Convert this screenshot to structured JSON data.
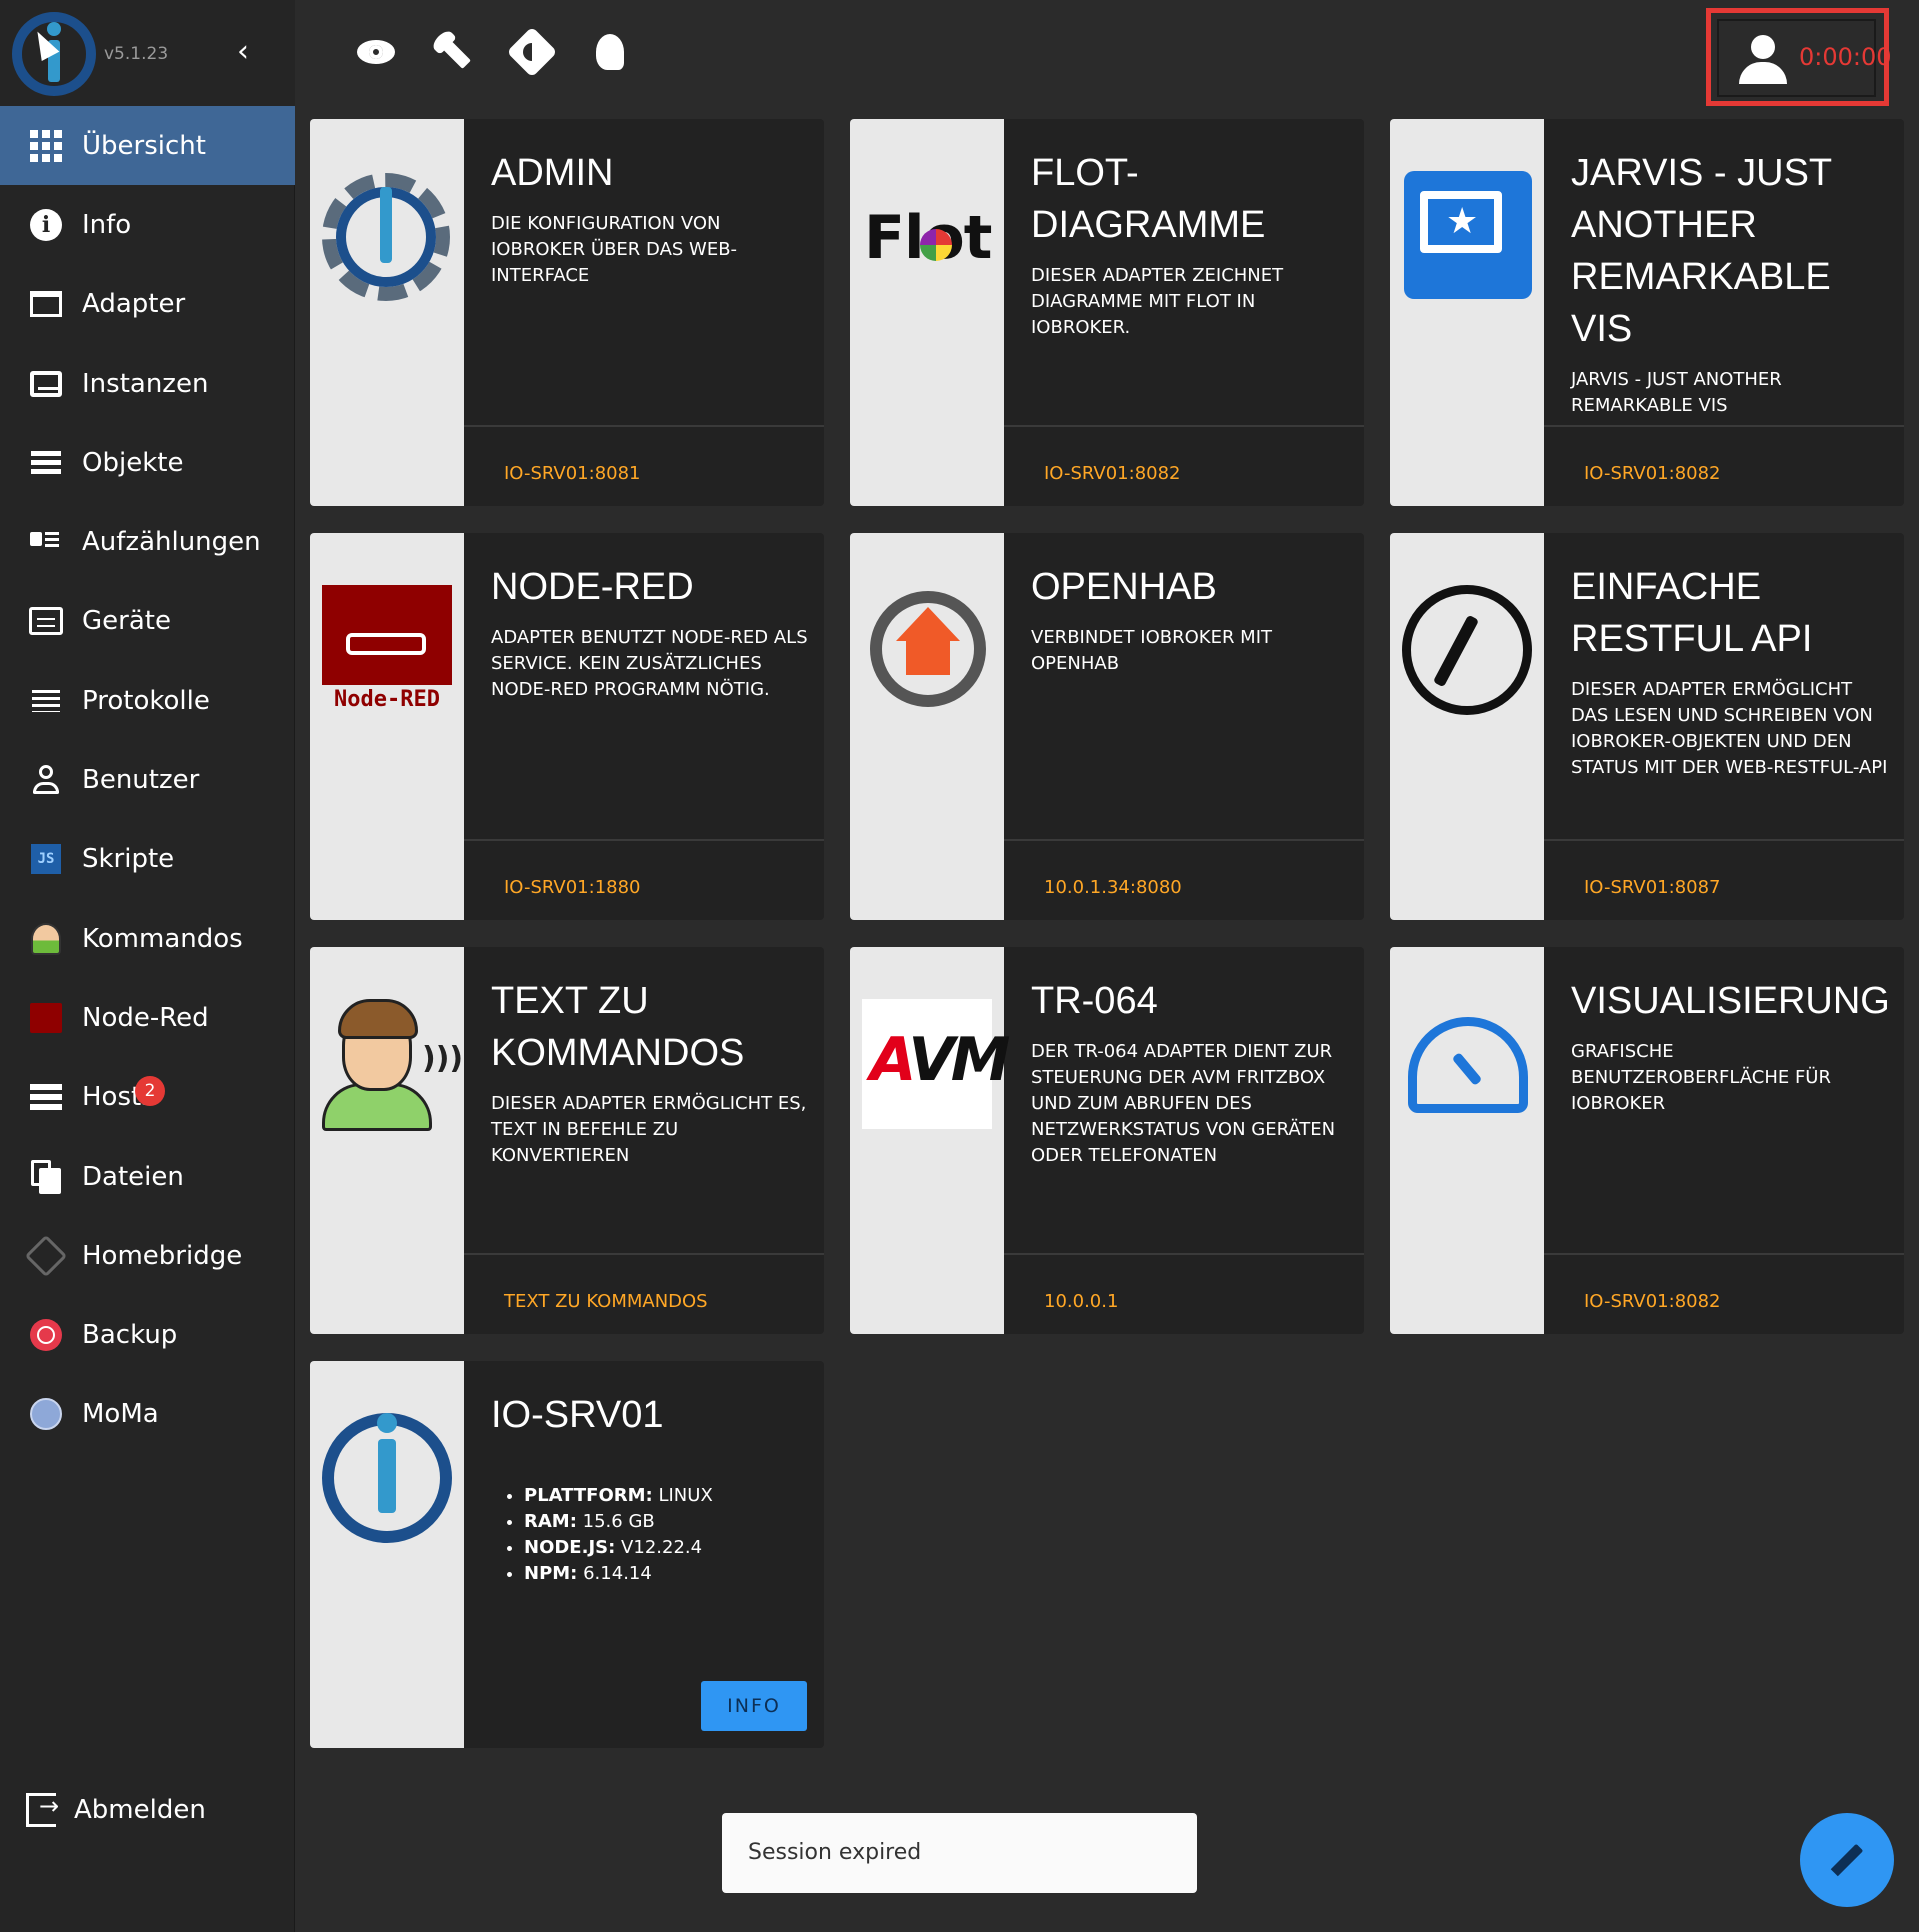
{
  "app": {
    "version": "v5.1.23"
  },
  "sidebar": {
    "items": [
      {
        "label": "Übersicht",
        "icon": "apps-grid-icon"
      },
      {
        "label": "Info",
        "icon": "info-icon"
      },
      {
        "label": "Adapter",
        "icon": "store-icon"
      },
      {
        "label": "Instanzen",
        "icon": "instances-icon"
      },
      {
        "label": "Objekte",
        "icon": "list-icon"
      },
      {
        "label": "Aufzählungen",
        "icon": "enums-icon"
      },
      {
        "label": "Geräte",
        "icon": "devices-icon"
      },
      {
        "label": "Protokolle",
        "icon": "logs-icon"
      },
      {
        "label": "Benutzer",
        "icon": "user-icon"
      },
      {
        "label": "Skripte",
        "icon": "javascript-icon"
      },
      {
        "label": "Kommandos",
        "icon": "text2command-icon"
      },
      {
        "label": "Node-Red",
        "icon": "node-red-icon"
      },
      {
        "label": "Hosts",
        "icon": "hosts-icon",
        "badge": "2"
      },
      {
        "label": "Dateien",
        "icon": "files-icon"
      },
      {
        "label": "Homebridge",
        "icon": "homebridge-icon"
      },
      {
        "label": "Backup",
        "icon": "backup-icon"
      },
      {
        "label": "MoMa",
        "icon": "moma-icon"
      }
    ],
    "logout_label": "Abmelden"
  },
  "topbar": {
    "icons": [
      "eye-icon",
      "wrench-icon",
      "brightness-icon",
      "expert-mode-icon"
    ],
    "timer": "0:00:00"
  },
  "cards": [
    {
      "title": "ADMIN",
      "desc": "DIE KONFIGURATION VON IOBROKER ÜBER DAS WEB-INTERFACE",
      "link": "IO-SRV01:8081"
    },
    {
      "title": "FLOT-DIAGRAMME",
      "desc": "DIESER ADAPTER ZEICHNET DIAGRAMME MIT FLOT IN IOBROKER.",
      "link": "IO-SRV01:8082",
      "logo_text": "Flot"
    },
    {
      "title": "JARVIS - JUST ANOTHER REMARKABLE VIS",
      "desc": "JARVIS - JUST ANOTHER REMARKABLE VIS",
      "link": "IO-SRV01:8082"
    },
    {
      "title": "NODE-RED",
      "desc": "ADAPTER BENUTZT NODE-RED ALS SERVICE. KEIN ZUSÄTZLICHES NODE-RED PROGRAMM NÖTIG.",
      "link": "IO-SRV01:1880",
      "logo_text": "Node-RED"
    },
    {
      "title": "OPENHAB",
      "desc": "VERBINDET IOBROKER MIT OPENHAB",
      "link": "10.0.1.34:8080"
    },
    {
      "title": "EINFACHE RESTFUL API",
      "desc": "DIESER ADAPTER ERMÖGLICHT DAS LESEN UND SCHREIBEN VON IOBROKER-OBJEKTEN UND DEN STATUS MIT DER WEB-RESTFUL-API",
      "link": "IO-SRV01:8087"
    },
    {
      "title": "TEXT ZU KOMMANDOS",
      "desc": "DIESER ADAPTER ERMÖGLICHT ES, TEXT IN BEFEHLE ZU KONVERTIEREN",
      "link": "TEXT ZU KOMMANDOS"
    },
    {
      "title": "TR-064",
      "desc": "DER TR-064 ADAPTER DIENT ZUR STEUERUNG DER AVM FRITZBOX UND ZUM ABRUFEN DES NETZWERKSTATUS VON GERÄTEN ODER TELEFONATEN",
      "link": "10.0.0.1",
      "logo_text": "AVM"
    },
    {
      "title": "VISUALISIERUNG",
      "desc": "GRAFISCHE BENUTZEROBERFLÄCHE FÜR IOBROKER",
      "link": "IO-SRV01:8082"
    }
  ],
  "host_card": {
    "title": "IO-SRV01",
    "info": [
      {
        "key": "PLATTFORM:",
        "value": "LINUX"
      },
      {
        "key": "RAM:",
        "value": "15.6 GB"
      },
      {
        "key": "NODE.JS:",
        "value": "V12.22.4"
      },
      {
        "key": "NPM:",
        "value": "6.14.14"
      }
    ],
    "button": "INFO"
  },
  "snackbar": "Session expired",
  "colors": {
    "accent": "#3f6796",
    "link": "#ffa726",
    "alert": "#e53935",
    "fab": "#2f96f3"
  }
}
